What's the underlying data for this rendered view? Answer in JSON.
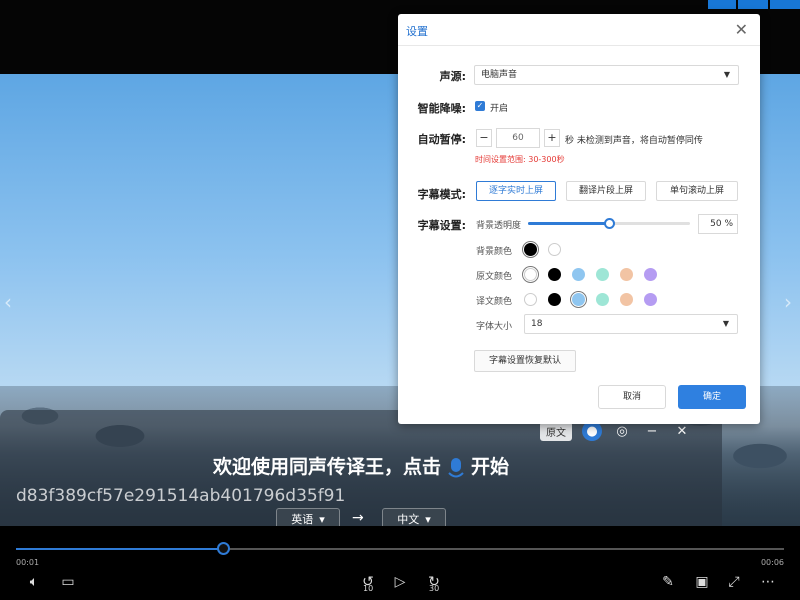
{
  "player": {
    "caption_main_before": "欢迎使用同声传译王，点击",
    "caption_main_after": "开始",
    "caption_hash": "d83f389cf57e291514ab401796d35f91",
    "source_lang": "英语",
    "target_lang": "中文",
    "original_chip": "原文",
    "time_current": "00:01",
    "time_total": "00:06",
    "progress": 0.27,
    "rewind_label": "10",
    "forward_label": "30"
  },
  "dialog": {
    "title": "设置",
    "audio_source_label": "声源:",
    "audio_source_value": "电脑声音",
    "noise_label": "智能降噪:",
    "noise_option": "开启",
    "pause_label": "自动暂停:",
    "pause_value": "60",
    "pause_desc": "秒 未检测到声音，将自动暂停同传",
    "pause_range": "时间设置范围: 30-300秒",
    "mode_label": "字幕模式:",
    "modes": [
      "逐字实时上屏",
      "翻译片段上屏",
      "单句滚动上屏"
    ],
    "subtitle_label": "字幕设置:",
    "opacity_label": "背景透明度",
    "opacity_value": "50",
    "opacity_unit": "%",
    "opacity_fraction": 0.5,
    "bg_color_label": "背景颜色",
    "orig_color_label": "原文颜色",
    "trans_color_label": "译文颜色",
    "font_size_label": "字体大小",
    "font_size_value": "18",
    "reset_label": "字幕设置恢复默认",
    "cancel_label": "取消",
    "ok_label": "确定"
  },
  "colors": {
    "accent": "#2f7bd6",
    "warning": "#e53935",
    "swatches": [
      "#ffffff",
      "#000000",
      "#8fc6f0",
      "#9ee6d6",
      "#f2c4a4",
      "#b59cf2"
    ]
  }
}
